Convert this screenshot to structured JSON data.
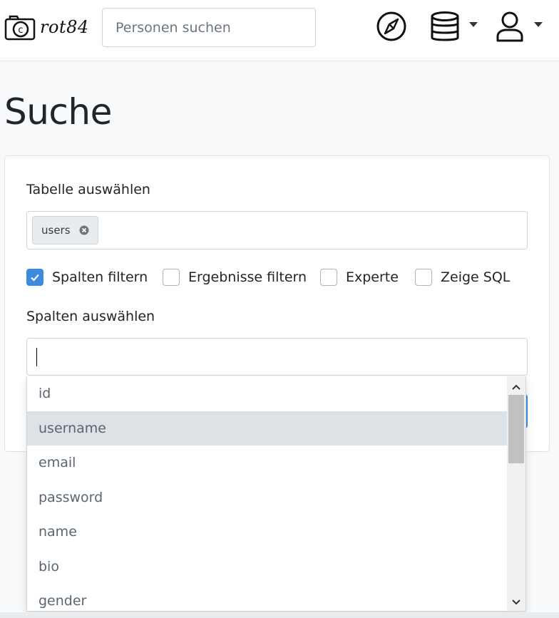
{
  "brand": {
    "name": "rot84",
    "logo_icon": "camera-icon"
  },
  "nav": {
    "search_placeholder": "Personen suchen",
    "icons": [
      "compass-icon",
      "database-icon",
      "user-icon"
    ]
  },
  "page": {
    "title": "Suche"
  },
  "form": {
    "table_label": "Tabelle auswählen",
    "selected_table": "users",
    "checkboxes": [
      {
        "label": "Spalten filtern",
        "checked": true
      },
      {
        "label": "Ergebnisse filtern",
        "checked": false
      },
      {
        "label": "Experte",
        "checked": false
      },
      {
        "label": "Zeige SQL",
        "checked": false
      }
    ],
    "columns_label": "Spalten auswählen",
    "columns_value": ""
  },
  "dropdown": {
    "options": [
      "id",
      "username",
      "email",
      "password",
      "name",
      "bio",
      "gender"
    ],
    "highlighted": "username"
  },
  "colors": {
    "accent": "#3b8ce0",
    "highlight": "#dde2e7"
  }
}
